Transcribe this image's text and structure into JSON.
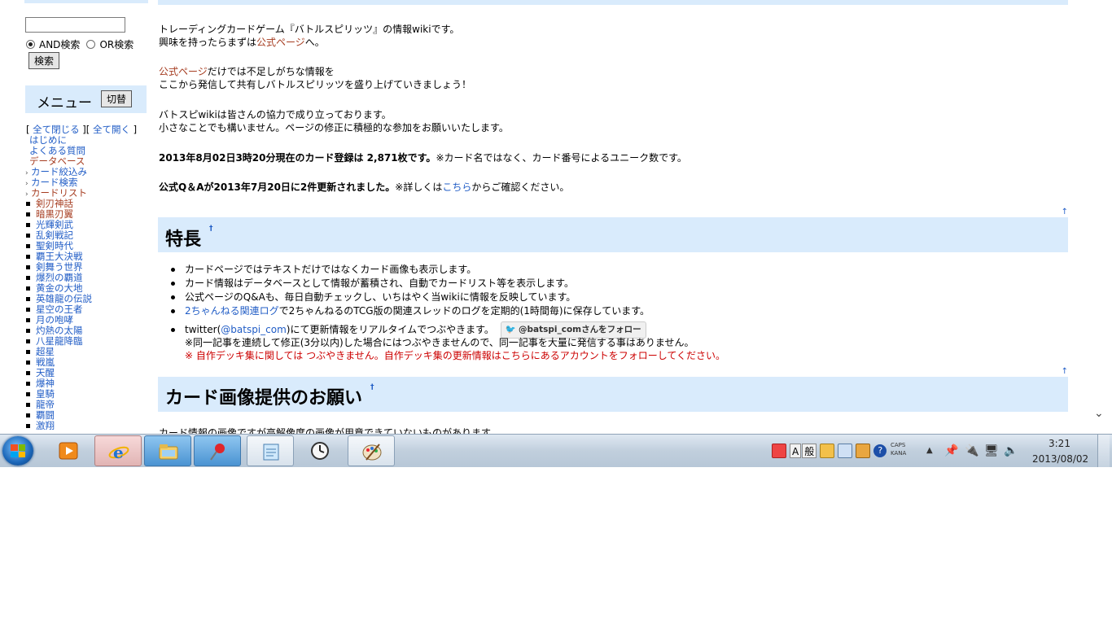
{
  "sidebar": {
    "radio_and": "AND検索",
    "radio_or": "OR検索",
    "search_button": "検索",
    "menu_title": "メニュー",
    "menu_toggle": "切替",
    "tree_open": "[ ",
    "collapse_all": "全て閉じる",
    "tree_mid": " ][ ",
    "expand_all": "全て開く",
    "tree_close": " ]",
    "items": [
      {
        "label": "はじめに",
        "kind": "plain"
      },
      {
        "label": "よくある質問",
        "kind": "plain"
      },
      {
        "label": "データベース",
        "kind": "visited"
      },
      {
        "label": "カード絞込み",
        "kind": "arrow"
      },
      {
        "label": "カード検索",
        "kind": "arrow"
      },
      {
        "label": "カードリスト",
        "kind": "arrow-visited"
      },
      {
        "label": "剣刃神話",
        "kind": "sq-visited"
      },
      {
        "label": "暗黒刃翼",
        "kind": "sq-visited"
      },
      {
        "label": "光輝剣武",
        "kind": "sq"
      },
      {
        "label": "乱剣戦記",
        "kind": "sq"
      },
      {
        "label": "聖剣時代",
        "kind": "sq"
      },
      {
        "label": "覇王大決戦",
        "kind": "sq"
      },
      {
        "label": "剣舞う世界",
        "kind": "sq"
      },
      {
        "label": "爆烈の覇道",
        "kind": "sq"
      },
      {
        "label": "黄金の大地",
        "kind": "sq"
      },
      {
        "label": "英雄龍の伝説",
        "kind": "sq"
      },
      {
        "label": "星空の王者",
        "kind": "sq"
      },
      {
        "label": "月の咆哮",
        "kind": "sq"
      },
      {
        "label": "灼熱の太陽",
        "kind": "sq"
      },
      {
        "label": "八星龍降臨",
        "kind": "sq"
      },
      {
        "label": "超星",
        "kind": "sq"
      },
      {
        "label": "戦嵐",
        "kind": "sq"
      },
      {
        "label": "天醒",
        "kind": "sq"
      },
      {
        "label": "爆神",
        "kind": "sq"
      },
      {
        "label": "皇騎",
        "kind": "sq"
      },
      {
        "label": "龍帝",
        "kind": "sq"
      },
      {
        "label": "覇闘",
        "kind": "sq"
      },
      {
        "label": "激翔",
        "kind": "sq"
      }
    ]
  },
  "main": {
    "intro1": "トレーディングカードゲーム『バトルスピリッツ』の情報wikiです。",
    "intro2_pre": "興味を持ったらまずは",
    "official_page": "公式ページ",
    "intro2_post": "へ。",
    "para2a_link": "公式ページ",
    "para2a_rest": "だけでは不足しがちな情報を",
    "para2b": "ここから発信して共有しバトルスピリッツを盛り上げていきましょう！",
    "para3a": "バトスピwikiは皆さんの協力で成り立っております。",
    "para3b": "小さなことでも構いません。ページの修正に積極的な参加をお願いいたします。",
    "card_count_bold": "2013年8月02日3時20分現在のカード登録は 2,871枚です。",
    "card_count_note": "※カード名ではなく、カード番号によるユニーク数です。",
    "qa_bold": "公式Q＆Aが2013年7月20日に2件更新されました。",
    "qa_note_pre": "※詳しくは",
    "qa_link": "こちら",
    "qa_note_post": "からご確認ください。",
    "top_link": "↑",
    "section1_title": "特長",
    "section_anchor": "†",
    "features": {
      "f1": "カードページではテキストだけではなくカード画像も表示します。",
      "f2": "カード情報はデータベースとして情報が蓄積され、自動でカードリスト等を表示します。",
      "f3": "公式ページのQ&Aも、毎日自動チェックし、いちはやく当wikiに情報を反映しています。",
      "f4_link": "2ちゃんねる関連ログ",
      "f4_rest": "で2ちゃんねるのTCG版の関連スレッドのログを定期的(1時間毎)に保存しています。",
      "f5_pre": "twitter(",
      "f5_link": "@batspi_com",
      "f5_post": ")にて更新情報をリアルタイムでつぶやきます。",
      "follow_button": "@batspi_comさんをフォロー",
      "f5_note": "※同一記事を連続して修正(3分以内)した場合にはつぶやきませんので、同一記事を大量に発信する事はありません。",
      "f5_warning": "※ 自作デッキ集に関しては つぶやきません。自作デッキ集の更新情報はこちらにあるアカウントをフォローしてください。"
    },
    "section2_title": "カード画像提供のお願い",
    "cut_line": "カード情報の画像ですが高解像度の画像が用意できていないものがあります。"
  },
  "taskbar": {
    "ime_a": "A",
    "ime_mode": "般",
    "caps": "CAPS",
    "kana": "KANA",
    "time": "3:21",
    "date": "2013/08/02"
  },
  "colors": {
    "link": "#215dc6",
    "visited": "#a63d21",
    "header_bg": "#d9ebfc",
    "warning": "#cc0000"
  }
}
